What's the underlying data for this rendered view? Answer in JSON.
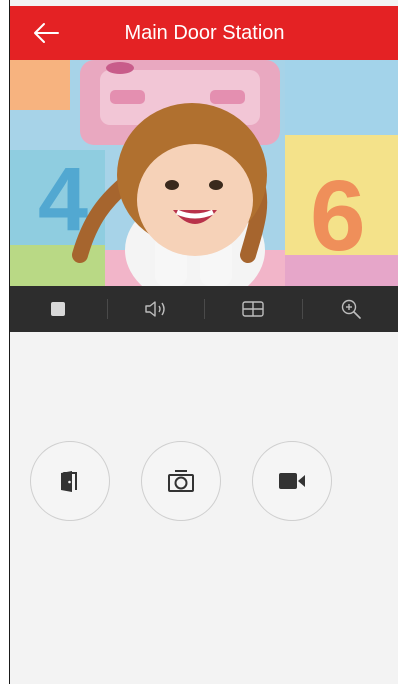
{
  "header": {
    "title": "Main Door Station",
    "back_icon": "arrow-left-icon",
    "background_color": "#e42224"
  },
  "video": {
    "description_icon": "live-camera-feed",
    "floor_digits": [
      "4",
      "6"
    ]
  },
  "toolbar": {
    "items": [
      {
        "icon": "stop-icon"
      },
      {
        "icon": "speaker-icon"
      },
      {
        "icon": "split-view-icon"
      },
      {
        "icon": "zoom-in-icon"
      }
    ],
    "background_color": "#2d2d2d"
  },
  "actions": [
    {
      "icon": "door-open-icon"
    },
    {
      "icon": "camera-snapshot-icon"
    },
    {
      "icon": "video-record-icon"
    }
  ]
}
